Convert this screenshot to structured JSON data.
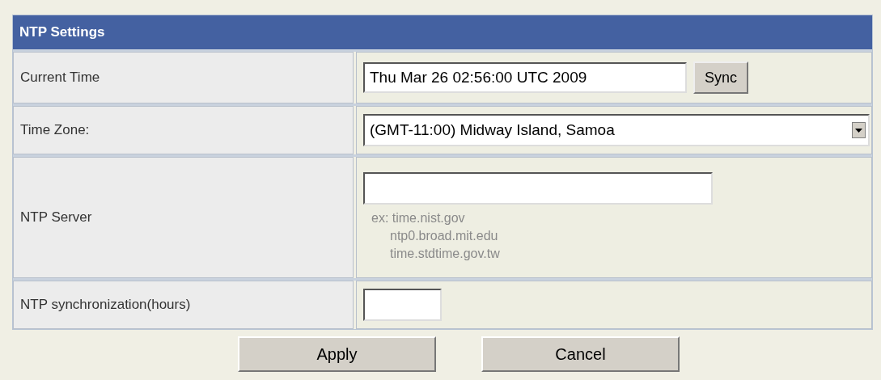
{
  "panel": {
    "title": "NTP Settings"
  },
  "rows": [
    {
      "kind": "time",
      "label": "Current Time",
      "value": "Thu Mar 26 02:56:00 UTC 2009",
      "button": "Sync"
    },
    {
      "kind": "select",
      "label": "Time Zone:",
      "value": "(GMT-11:00) Midway Island, Samoa"
    },
    {
      "kind": "server",
      "label": "NTP Server",
      "hints": [
        "ex: time.nist.gov",
        "ntp0.broad.mit.edu",
        "time.stdtime.gov.tw"
      ]
    },
    {
      "kind": "small",
      "label": "NTP synchronization(hours)"
    }
  ],
  "buttons": [
    "Apply",
    "Cancel"
  ]
}
